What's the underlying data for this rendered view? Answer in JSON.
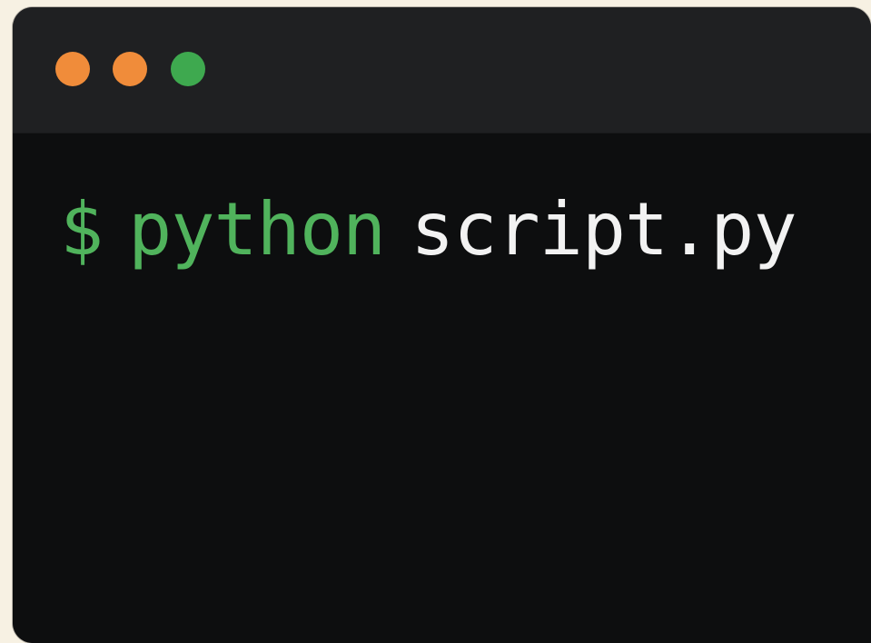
{
  "window": {
    "controls": [
      {
        "name": "orange-dot",
        "color": "#f08c3a"
      },
      {
        "name": "orange-dot",
        "color": "#f08c3a"
      },
      {
        "name": "green-dot",
        "color": "#3ea94f"
      }
    ]
  },
  "terminal": {
    "prompt": "$",
    "command": "python",
    "argument": "script.py",
    "colors": {
      "prompt": "#50b35c",
      "command": "#50b35c",
      "argument": "#f2f2f2",
      "background": "#0d0e0f",
      "titlebar": "#1f2022",
      "page_background": "#f7f1e3"
    }
  }
}
